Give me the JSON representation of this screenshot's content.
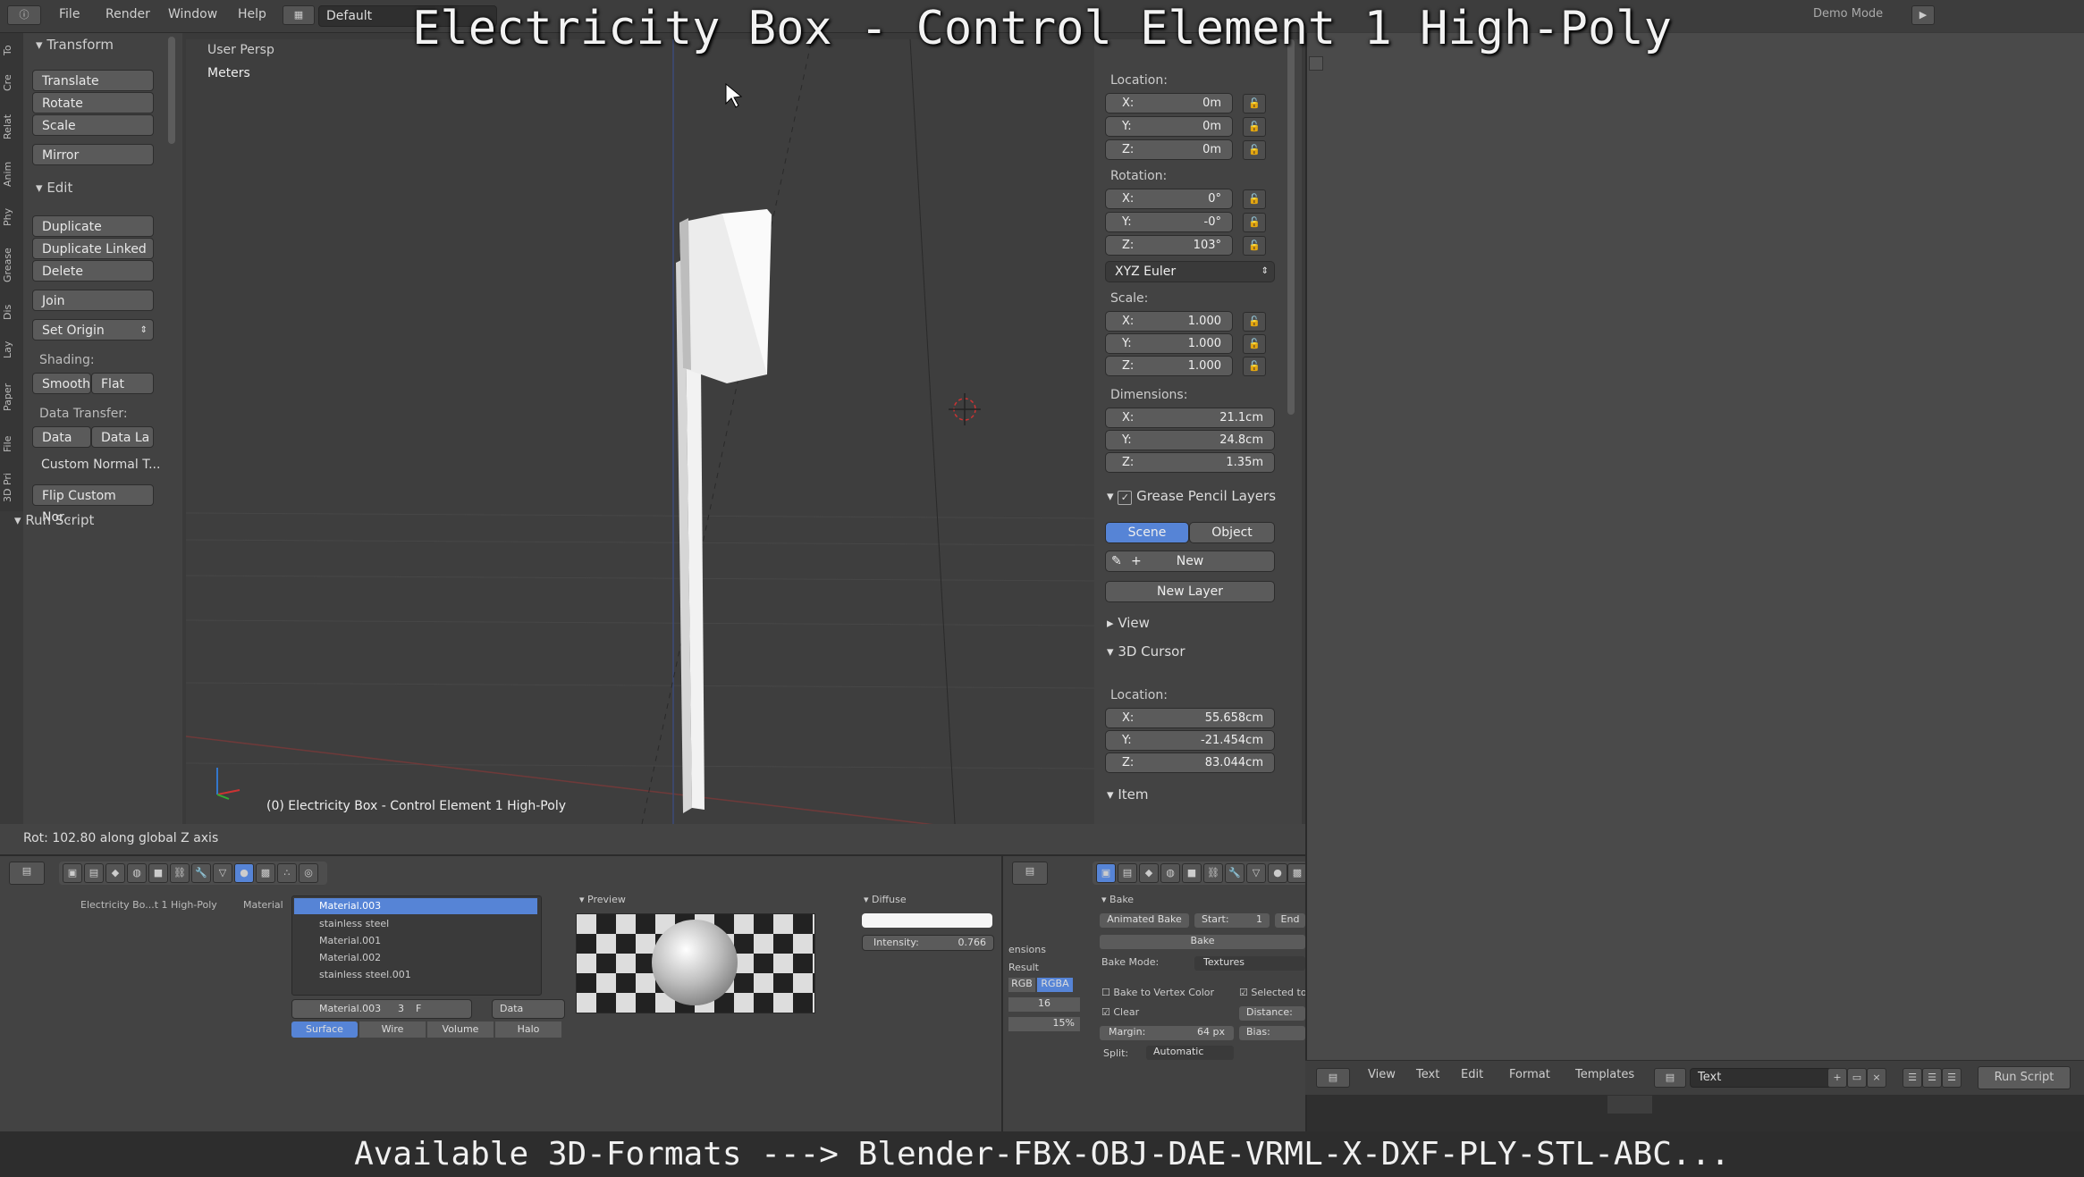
{
  "overlay": {
    "title": "Electricity Box - Control Element 1 High-Poly",
    "bottom": "Available 3D-Formats ---> Blender-FBX-OBJ-DAE-VRML-X-DXF-PLY-STL-ABC..."
  },
  "topbar": {
    "menus": [
      "File",
      "Render",
      "Window",
      "Help"
    ],
    "layout": "Default",
    "right_text": "Demo Mode"
  },
  "vertical_tabs": [
    "To",
    "Cre",
    "Relat",
    "Anim",
    "Phy",
    "Grease",
    "Dis",
    "Lay",
    "Paper",
    "File",
    "3D Pri"
  ],
  "toolshelf": {
    "transform_header": "Transform",
    "translate": "Translate",
    "rotate": "Rotate",
    "scale": "Scale",
    "mirror": "Mirror",
    "edit_header": "Edit",
    "duplicate": "Duplicate",
    "duplicate_linked": "Duplicate Linked",
    "delete": "Delete",
    "join": "Join",
    "set_origin": "Set Origin",
    "shading_label": "Shading:",
    "smooth": "Smooth",
    "flat": "Flat",
    "data_transfer_label": "Data Transfer:",
    "data": "Data",
    "data_la": "Data La",
    "custom_normal": "Custom Normal T...",
    "flip_custom": "Flip Custom Nor...",
    "run_script": "Run Script"
  },
  "viewport": {
    "view_name": "User Persp",
    "units": "Meters",
    "object_label": "(0) Electricity Box - Control Element 1 High-Poly"
  },
  "npanel": {
    "location_label": "Location:",
    "location": [
      [
        "X:",
        "0m"
      ],
      [
        "Y:",
        "0m"
      ],
      [
        "Z:",
        "0m"
      ]
    ],
    "rotation_label": "Rotation:",
    "rotation": [
      [
        "X:",
        "0°"
      ],
      [
        "Y:",
        "-0°"
      ],
      [
        "Z:",
        "103°"
      ]
    ],
    "rotation_mode": "XYZ Euler",
    "scale_label": "Scale:",
    "scale": [
      [
        "X:",
        "1.000"
      ],
      [
        "Y:",
        "1.000"
      ],
      [
        "Z:",
        "1.000"
      ]
    ],
    "dimensions_label": "Dimensions:",
    "dimensions": [
      [
        "X:",
        "21.1cm"
      ],
      [
        "Y:",
        "24.8cm"
      ],
      [
        "Z:",
        "1.35m"
      ]
    ],
    "grease_pencil_header": "Grease Pencil Layers",
    "scene": "Scene",
    "object": "Object",
    "new": "New",
    "new_layer": "New Layer",
    "view_header": "View",
    "cursor_header": "3D Cursor",
    "cursor_location_label": "Location:",
    "cursor": [
      [
        "X:",
        "55.658cm"
      ],
      [
        "Y:",
        "-21.454cm"
      ],
      [
        "Z:",
        "83.044cm"
      ]
    ],
    "item_header": "Item"
  },
  "status": {
    "text": "Rot: 102.80 along global Z axis"
  },
  "properties": {
    "breadcrumb_object": "Electricity Bo...t 1 High-Poly",
    "breadcrumb_material": "Material",
    "materials": [
      "Material.003",
      "stainless steel",
      "Material.001",
      "Material.002",
      "stainless steel.001"
    ],
    "material_name": "Material.003",
    "material_users": "3",
    "material_f": "F",
    "data_select": "Data",
    "mat_tabs": [
      "Surface",
      "Wire",
      "Volume",
      "Halo"
    ],
    "preview_header": "Preview",
    "diffuse_header": "Diffuse",
    "intensity_label": "Intensity:",
    "intensity_value": "0.766"
  },
  "bake": {
    "header": "Bake",
    "animated_bake": "Animated Bake",
    "start_label": "Start:",
    "start_value": "1",
    "end_label": "End",
    "bake_button": "Bake",
    "bake_mode_label": "Bake Mode:",
    "bake_mode": "Textures",
    "bake_vertex": "Bake to Vertex Color",
    "selected_to": "Selected to",
    "clear": "Clear",
    "distance": "Distance:",
    "margin_label": "Margin:",
    "margin_value": "64 px",
    "bias": "Bias:",
    "split_label": "Split:",
    "split_value": "Automatic",
    "left_partial": "ensions",
    "result": "Result",
    "rgb": "RGB",
    "rgba": "RGBA",
    "value16": "16",
    "value15": "15%"
  },
  "text_editor": {
    "menus": [
      "View",
      "Text",
      "Edit",
      "Format",
      "Templates"
    ],
    "text_name": "Text",
    "run_script": "Run Script"
  }
}
